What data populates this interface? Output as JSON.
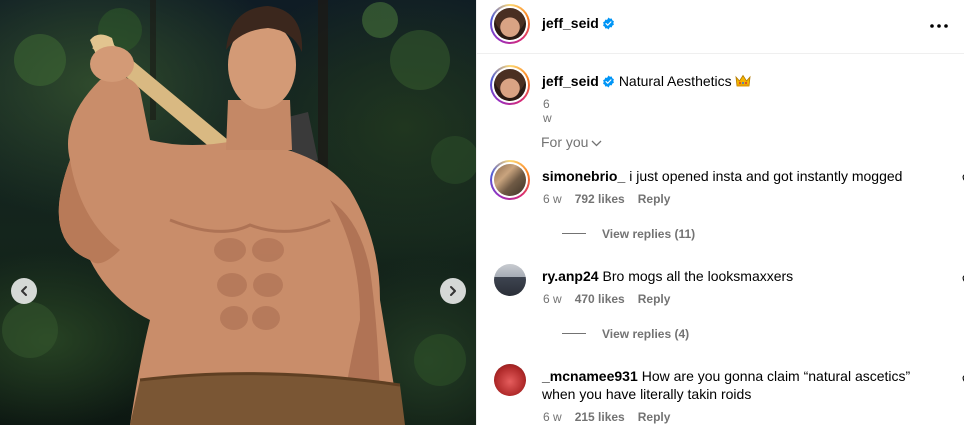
{
  "post": {
    "author": "jeff_seid",
    "caption": "Natural Aesthetics",
    "caption_time": "6 w",
    "sort_label": "For you"
  },
  "icons": {
    "verified": "verified-badge-icon",
    "crown": "crown-emoji-icon",
    "more": "more-horizontal-icon",
    "heart": "heart-outline-icon",
    "prev": "chevron-left-icon",
    "next": "chevron-right-icon",
    "dropdown": "chevron-down-icon"
  },
  "colors": {
    "verified_blue": "#0095f6",
    "muted_text": "#737373",
    "divider": "#efefef"
  },
  "comments": [
    {
      "username": "simonebrio_",
      "text": "i just opened insta and got instantly mogged",
      "time": "6 w",
      "likes": "792 likes",
      "reply_label": "Reply",
      "view_replies": "View replies (11)"
    },
    {
      "username": "ry.anp24",
      "text": "Bro mogs all the looksmaxxers",
      "time": "6 w",
      "likes": "470 likes",
      "reply_label": "Reply",
      "view_replies": "View replies (4)"
    },
    {
      "username": "_mcnamee931",
      "text": "How are you gonna claim “natural ascetics” when you have literally takin roids",
      "time": "6 w",
      "likes": "215 likes",
      "reply_label": "Reply"
    }
  ]
}
